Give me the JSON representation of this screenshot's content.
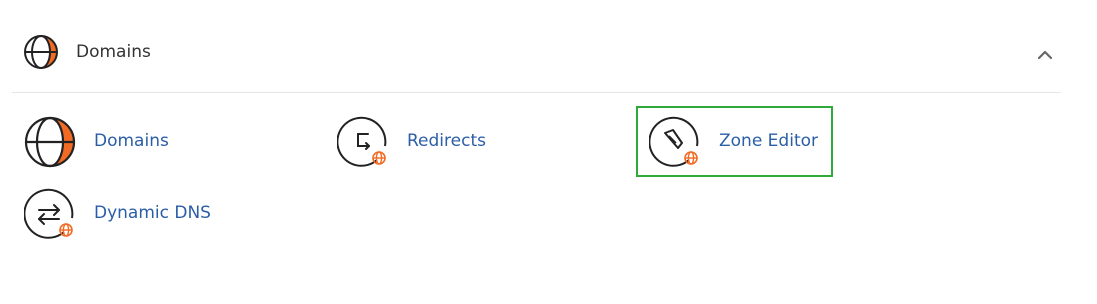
{
  "section": {
    "title": "Domains",
    "icon": "globe-icon",
    "collapse_icon": "chevron-up-icon"
  },
  "items": [
    {
      "label": "Domains",
      "icon": "globe-icon"
    },
    {
      "label": "Redirects",
      "icon": "redirect-icon"
    },
    {
      "label": "Zone Editor",
      "icon": "zone-editor-icon"
    },
    {
      "label": "Dynamic DNS",
      "icon": "dynamic-dns-icon"
    }
  ],
  "colors": {
    "accent_orange": "#f26b25",
    "link_blue": "#2a5ea7",
    "highlight_green": "#2eaa3a"
  }
}
